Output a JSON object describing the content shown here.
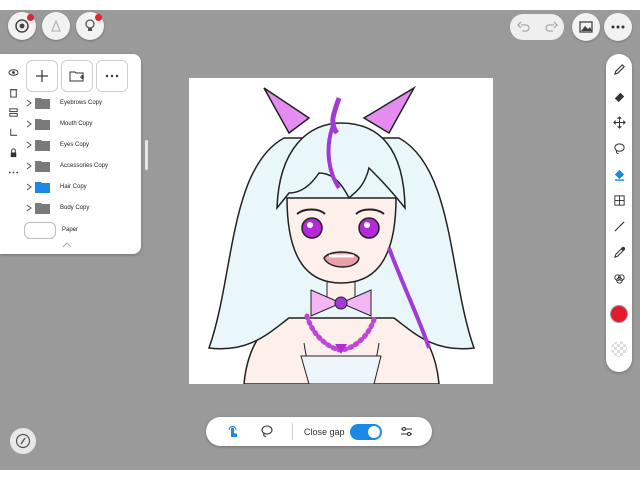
{
  "colors": {
    "accent": "#1b88e6",
    "current_color": "#e31b2b",
    "notification": "#e0232d",
    "background": "#9a9a9a"
  },
  "top_bar": {
    "left_icons": [
      "gallery-icon",
      "account-icon",
      "tips-icon"
    ],
    "right_icons": [
      "undo-icon",
      "redo-icon",
      "image-icon",
      "more-icon"
    ]
  },
  "layer_panel": {
    "actions": [
      "add-layer-icon",
      "add-folder-icon",
      "more-icon"
    ],
    "side_tools": [
      "visibility-icon",
      "trash-icon",
      "merge-icon",
      "clip-icon",
      "lock-icon",
      "more-icon"
    ],
    "layers": [
      {
        "label": "Eyebrows Copy",
        "type": "folder",
        "selected": false
      },
      {
        "label": "Mouth Copy",
        "type": "folder",
        "selected": false
      },
      {
        "label": "Eyes Copy",
        "type": "folder",
        "selected": false
      },
      {
        "label": "Accessories Copy",
        "type": "folder",
        "selected": false
      },
      {
        "label": "Hair Copy",
        "type": "folder",
        "selected": true
      },
      {
        "label": "Body Copy",
        "type": "folder",
        "selected": false
      }
    ],
    "paper_label": "Paper"
  },
  "tools": [
    "pen-icon",
    "eraser-icon",
    "move-icon",
    "lasso-icon",
    "fill-icon",
    "grid-icon",
    "line-icon",
    "eyedropper-icon",
    "filter-icon"
  ],
  "bottom_bar": {
    "close_gap_label": "Close gap",
    "close_gap_enabled": true
  }
}
